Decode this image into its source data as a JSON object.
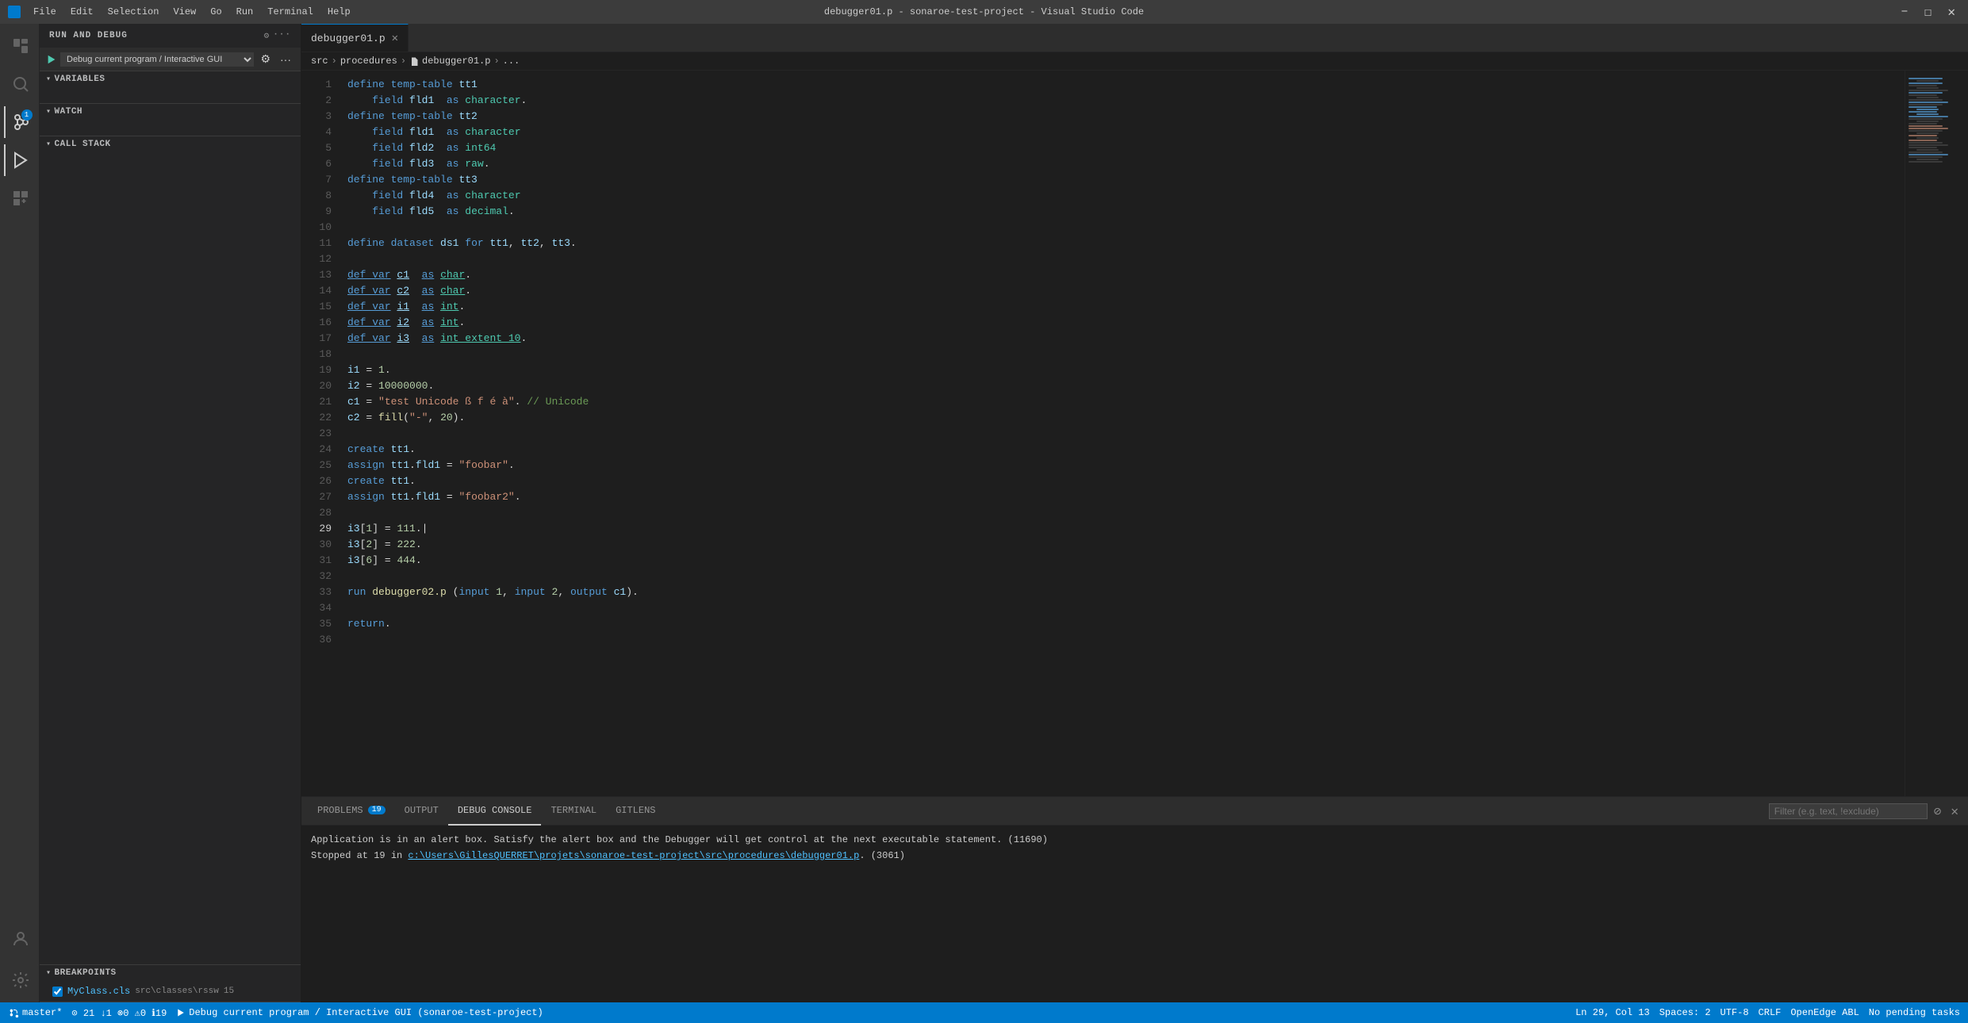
{
  "titleBar": {
    "title": "debugger01.p - sonaroe-test-project - Visual Studio Code",
    "menuItems": [
      "File",
      "Edit",
      "Selection",
      "View",
      "Go",
      "Run",
      "Terminal",
      "Help"
    ],
    "windowControls": [
      "–",
      "☐",
      "✕"
    ]
  },
  "activityBar": {
    "icons": [
      {
        "name": "explorer-icon",
        "symbol": "⬜",
        "active": false
      },
      {
        "name": "search-icon",
        "symbol": "🔍",
        "active": false
      },
      {
        "name": "source-control-icon",
        "symbol": "⎇",
        "active": false
      },
      {
        "name": "debug-icon",
        "symbol": "▷",
        "active": true
      },
      {
        "name": "extensions-icon",
        "symbol": "⊞",
        "active": false
      },
      {
        "name": "remote-icon",
        "symbol": "⊙",
        "active": false
      },
      {
        "name": "accounts-icon",
        "symbol": "👤",
        "active": false
      },
      {
        "name": "settings-icon",
        "symbol": "⚙",
        "active": false
      }
    ]
  },
  "sidebar": {
    "title": "RUN AND DEBUG",
    "debugConfig": "Debug current program / Interactive GUI",
    "sections": {
      "variables": {
        "label": "VARIABLES",
        "expanded": true
      },
      "watch": {
        "label": "WATCH",
        "expanded": true
      },
      "callStack": {
        "label": "CALL STACK",
        "expanded": true
      },
      "breakpoints": {
        "label": "BREAKPOINTS",
        "expanded": true
      }
    },
    "breakpoints": [
      {
        "name": "MyClass.cls",
        "location": "src\\classes\\rssw",
        "line": 15,
        "enabled": true
      }
    ]
  },
  "editor": {
    "tab": {
      "filename": "debugger01.p",
      "dirty": false
    },
    "breadcrumb": [
      "src",
      "procedures",
      "debugger01.p",
      "..."
    ],
    "lines": [
      {
        "num": 1,
        "text": "define temp-table tt1"
      },
      {
        "num": 2,
        "text": "  field fld1  as character."
      },
      {
        "num": 3,
        "text": "define temp-table tt2"
      },
      {
        "num": 4,
        "text": "  field fld1  as character"
      },
      {
        "num": 5,
        "text": "  field fld2  as int64"
      },
      {
        "num": 6,
        "text": "  field fld3  as raw."
      },
      {
        "num": 7,
        "text": "define temp-table tt3"
      },
      {
        "num": 8,
        "text": "  field fld4  as character"
      },
      {
        "num": 9,
        "text": "  field fld5  as decimal."
      },
      {
        "num": 10,
        "text": ""
      },
      {
        "num": 11,
        "text": "define dataset ds1 for tt1, tt2, tt3."
      },
      {
        "num": 12,
        "text": ""
      },
      {
        "num": 13,
        "text": "def var c1  as char."
      },
      {
        "num": 14,
        "text": "def var c2  as char."
      },
      {
        "num": 15,
        "text": "def var i1  as int."
      },
      {
        "num": 16,
        "text": "def var i2  as int."
      },
      {
        "num": 17,
        "text": "def var i3  as int extent 10."
      },
      {
        "num": 18,
        "text": ""
      },
      {
        "num": 19,
        "text": "i1 = 1."
      },
      {
        "num": 20,
        "text": "i2 = 10000000."
      },
      {
        "num": 21,
        "text": "c1 = \"test Unicode ß f é à\". // Unicode"
      },
      {
        "num": 22,
        "text": "c2 = fill(\"-\", 20)."
      },
      {
        "num": 23,
        "text": ""
      },
      {
        "num": 24,
        "text": "create tt1."
      },
      {
        "num": 25,
        "text": "assign tt1.fld1 = \"foobar\"."
      },
      {
        "num": 26,
        "text": "create tt1."
      },
      {
        "num": 27,
        "text": "assign tt1.fld1 = \"foobar2\"."
      },
      {
        "num": 28,
        "text": ""
      },
      {
        "num": 29,
        "text": "i3[1] = 111."
      },
      {
        "num": 30,
        "text": "i3[2] = 222."
      },
      {
        "num": 31,
        "text": "i3[6] = 444."
      },
      {
        "num": 32,
        "text": ""
      },
      {
        "num": 33,
        "text": "run debugger02.p (input 1, input 2, output c1)."
      },
      {
        "num": 34,
        "text": ""
      },
      {
        "num": 35,
        "text": "return."
      },
      {
        "num": 36,
        "text": ""
      }
    ]
  },
  "panel": {
    "tabs": [
      {
        "label": "PROBLEMS",
        "badge": "19",
        "active": false
      },
      {
        "label": "OUTPUT",
        "badge": null,
        "active": false
      },
      {
        "label": "DEBUG CONSOLE",
        "badge": null,
        "active": true
      },
      {
        "label": "TERMINAL",
        "badge": null,
        "active": false
      },
      {
        "label": "GITLENS",
        "badge": null,
        "active": false
      }
    ],
    "filterPlaceholder": "Filter (e.g. text, !exclude)",
    "consoleLines": [
      "Application is in an alert box. Satisfy the alert box and the Debugger will get control at the next executable statement. (11690)",
      "Stopped at 19 in c:\\Users\\GillesQUERRET\\projets\\sonaroe-test-project\\src\\procedures\\debugger01.p. (3061)"
    ]
  },
  "statusBar": {
    "debugMode": true,
    "left": [
      {
        "icon": "branch-icon",
        "text": "master*"
      },
      {
        "icon": "sync-icon",
        "text": "⊙ 21 ↓1 ⊗0 ⚠0 ℹ19"
      },
      {
        "icon": "debug-run-icon",
        "text": "Debug current program / Interactive GUI (sonaroe-test-project)"
      }
    ],
    "right": [
      {
        "label": "Ln 29, Col 13"
      },
      {
        "label": "Spaces: 2"
      },
      {
        "label": "UTF-8"
      },
      {
        "label": "CRLF"
      },
      {
        "label": "OpenEdge ABL"
      },
      {
        "label": "No pending tasks"
      }
    ]
  }
}
